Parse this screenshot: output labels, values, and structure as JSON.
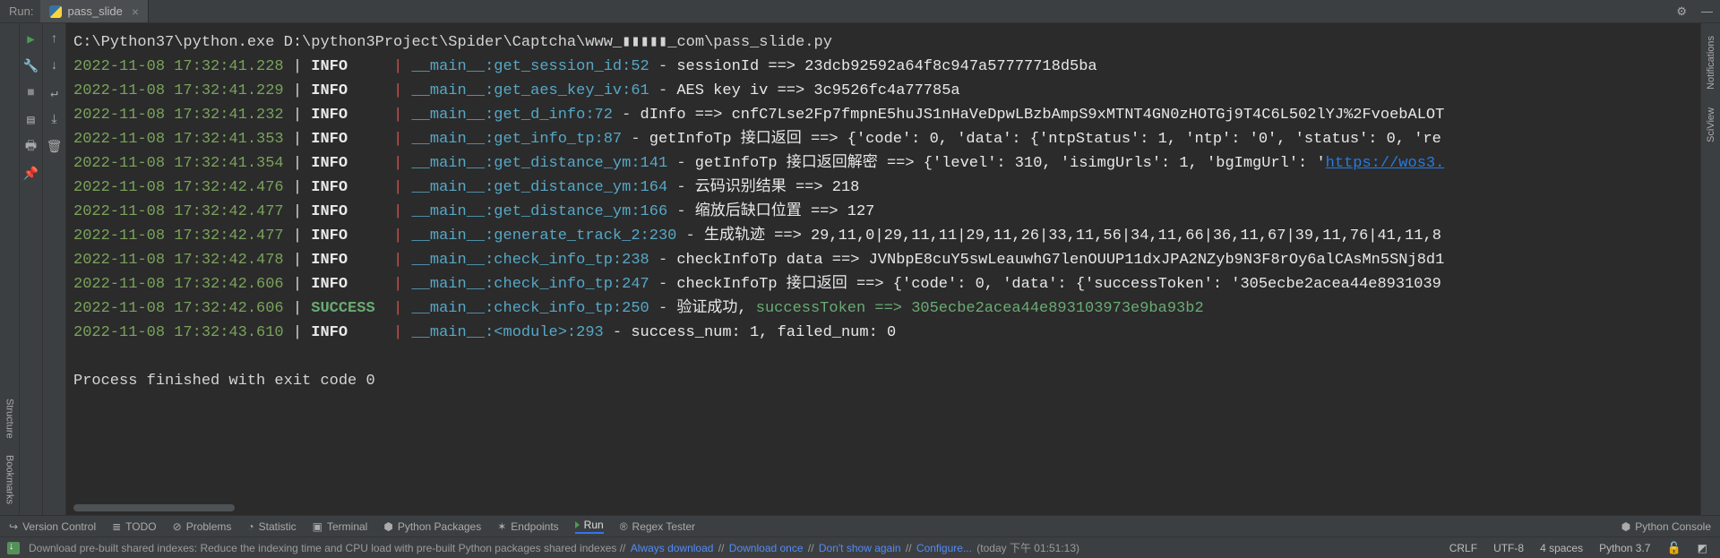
{
  "header": {
    "label": "Run:",
    "tab_name": "pass_slide"
  },
  "left_vert_tabs": [
    "Structure",
    "Bookmarks"
  ],
  "right_vert_tabs": [
    "Notifications",
    "SciView"
  ],
  "command_line": "C:\\Python37\\python.exe D:\\python3Project\\Spider\\Captcha\\www_▮▮▮▮▮_com\\pass_slide.py",
  "log_rows": [
    {
      "ts": "2022-11-08 17:32:41.228",
      "level": "INFO",
      "src": "__main__",
      "fn": "get_session_id",
      "ln": "52",
      "msg": "sessionId ==> 23dcb92592a64f8c947a57777718d5ba"
    },
    {
      "ts": "2022-11-08 17:32:41.229",
      "level": "INFO",
      "src": "__main__",
      "fn": "get_aes_key_iv",
      "ln": "61",
      "msg": "AES key iv ==> 3c9526fc4a77785a"
    },
    {
      "ts": "2022-11-08 17:32:41.232",
      "level": "INFO",
      "src": "__main__",
      "fn": "get_d_info",
      "ln": "72",
      "msg": "dInfo ==> cnfC7Lse2Fp7fmpnE5huJS1nHaVeDpwLBzbAmpS9xMTNT4GN0zHOTGj9T4C6L502lYJ%2FvoebALOT"
    },
    {
      "ts": "2022-11-08 17:32:41.353",
      "level": "INFO",
      "src": "__main__",
      "fn": "get_info_tp",
      "ln": "87",
      "msg": "getInfoTp 接口返回 ==> {'code': 0, 'data': {'ntpStatus': 1, 'ntp': '0', 'status': 0, 're"
    },
    {
      "ts": "2022-11-08 17:32:41.354",
      "level": "INFO",
      "src": "__main__",
      "fn": "get_distance_ym",
      "ln": "141",
      "msg": "getInfoTp 接口返回解密 ==> {'level': 310, 'isimgUrls': 1, 'bgImgUrl': '",
      "link": "https://wos3."
    },
    {
      "ts": "2022-11-08 17:32:42.476",
      "level": "INFO",
      "src": "__main__",
      "fn": "get_distance_ym",
      "ln": "164",
      "msg": "云码识别结果 ==> 218"
    },
    {
      "ts": "2022-11-08 17:32:42.477",
      "level": "INFO",
      "src": "__main__",
      "fn": "get_distance_ym",
      "ln": "166",
      "msg": "缩放后缺口位置 ==> 127"
    },
    {
      "ts": "2022-11-08 17:32:42.477",
      "level": "INFO",
      "src": "__main__",
      "fn": "generate_track_2",
      "ln": "230",
      "msg": "生成轨迹 ==> 29,11,0|29,11,11|29,11,26|33,11,56|34,11,66|36,11,67|39,11,76|41,11,8"
    },
    {
      "ts": "2022-11-08 17:32:42.478",
      "level": "INFO",
      "src": "__main__",
      "fn": "check_info_tp",
      "ln": "238",
      "msg": "checkInfoTp data ==> JVNbpE8cuY5swLeauwhG7lenOUUP11dxJPA2NZyb9N3F8rOy6alCAsMn5SNj8d1"
    },
    {
      "ts": "2022-11-08 17:32:42.606",
      "level": "INFO",
      "src": "__main__",
      "fn": "check_info_tp",
      "ln": "247",
      "msg": "checkInfoTp 接口返回 ==> {'code': 0, 'data': {'successToken': '305ecbe2acea44e8931039"
    },
    {
      "ts": "2022-11-08 17:32:42.606",
      "level": "SUCCESS",
      "src": "__main__",
      "fn": "check_info_tp",
      "ln": "250",
      "msg": "验证成功, ",
      "msg2": "successToken ==> 305ecbe2acea44e893103973e9ba93b2"
    },
    {
      "ts": "2022-11-08 17:32:43.610",
      "level": "INFO",
      "src": "__main__",
      "fn": "<module>",
      "ln": "293",
      "msg": "success_num: 1, failed_num: 0"
    }
  ],
  "process_finished": "Process finished with exit code 0",
  "bottom_tools": {
    "version_control": "Version Control",
    "todo": "TODO",
    "problems": "Problems",
    "statistic": "Statistic",
    "terminal": "Terminal",
    "python_packages": "Python Packages",
    "endpoints": "Endpoints",
    "run": "Run",
    "regex_tester": "Regex Tester",
    "python_console": "Python Console"
  },
  "status": {
    "msg_prefix": "Download pre-built shared indexes: Reduce the indexing time and CPU load with pre-built Python packages shared indexes // ",
    "link_always": "Always download",
    "sep": " // ",
    "link_once": "Download once",
    "link_dont": "Don't show again",
    "link_conf": "Configure...",
    "msg_suffix": " (today 下午 01:51:13)",
    "right": {
      "crlf": "CRLF",
      "enc": "UTF-8",
      "indent": "4 spaces",
      "py": "Python 3.7"
    }
  }
}
